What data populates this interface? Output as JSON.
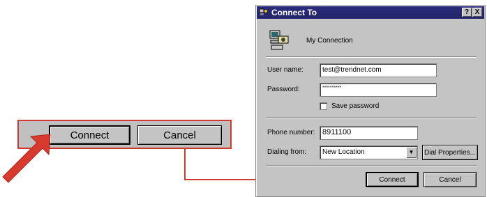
{
  "zoom": {
    "connect_label": "Connect",
    "cancel_label": "Cancel"
  },
  "dialog": {
    "title": "Connect To",
    "help_button": "?",
    "close_button": "X",
    "connection_name": "My Connection",
    "username_label": "User name:",
    "username_value": "test@trendnet.com",
    "password_label": "Password:",
    "password_value": "**********",
    "save_password_label": "Save password",
    "save_password_checked": false,
    "phone_label": "Phone number:",
    "phone_value": "8911100",
    "dialing_from_label": "Dialing from:",
    "dialing_from_value": "New Location",
    "dial_properties_label": "Dial Properties...",
    "connect_label": "Connect",
    "cancel_label": "Cancel"
  },
  "colors": {
    "title_bar": "#23246a",
    "annotation_red": "#d03a30",
    "face": "#c4c4c4"
  }
}
